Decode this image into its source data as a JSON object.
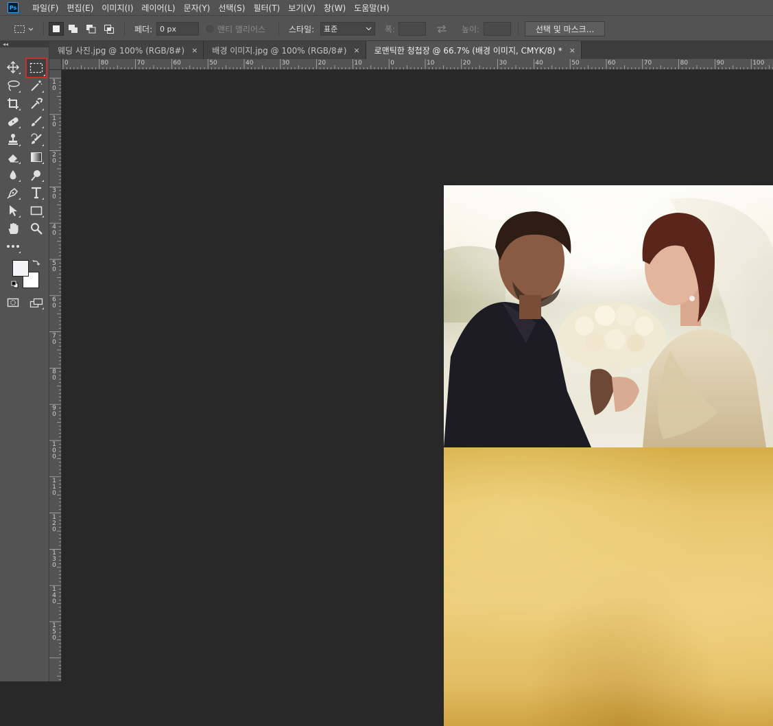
{
  "app": {
    "logo_text": "Ps"
  },
  "menu": [
    "파일(F)",
    "편집(E)",
    "이미지(I)",
    "레이어(L)",
    "문자(Y)",
    "선택(S)",
    "필터(T)",
    "보기(V)",
    "창(W)",
    "도움말(H)"
  ],
  "options": {
    "feather_label": "페더:",
    "feather_value": "0 px",
    "antialias_label": "앤티 앨리어스",
    "style_label": "스타일:",
    "style_value": "표준",
    "width_label": "폭:",
    "height_label": "높이:",
    "select_mask_label": "선택 및 마스크..."
  },
  "toolbar": {
    "collapse_label": "◂◂"
  },
  "tabs": [
    {
      "label": "웨딩 사진.jpg @ 100% (RGB/8#)",
      "close": "×",
      "active": false
    },
    {
      "label": "배경 이미지.jpg @ 100% (RGB/8#)",
      "close": "×",
      "active": false
    },
    {
      "label": "로맨틱한 청첩장 @ 66.7% (배경 이미지, CMYK/8) *",
      "close": "×",
      "active": true
    }
  ],
  "ruler_h_labels": [
    "0",
    "80",
    "70",
    "60",
    "50",
    "40",
    "30",
    "20",
    "10",
    "0",
    "10",
    "20",
    "30",
    "40",
    "50",
    "60",
    "70",
    "80",
    "90",
    "100"
  ],
  "ruler_v_labels": [
    "1\n0",
    "1\n0",
    "2\n0",
    "3\n0",
    "4\n0",
    "5\n0",
    "6\n0",
    "7\n0",
    "8\n0",
    "9\n0",
    "1\n0\n0",
    "1\n1\n0",
    "1\n2\n0",
    "1\n3\n0",
    "1\n4\n0",
    "1\n5\n0"
  ],
  "colors": {
    "foreground": "#f4f4f6",
    "background": "#ffffff",
    "selected_tool_outline": "#c9302c"
  },
  "document": {
    "layers": [
      "wedding-photo",
      "paper-background"
    ]
  }
}
